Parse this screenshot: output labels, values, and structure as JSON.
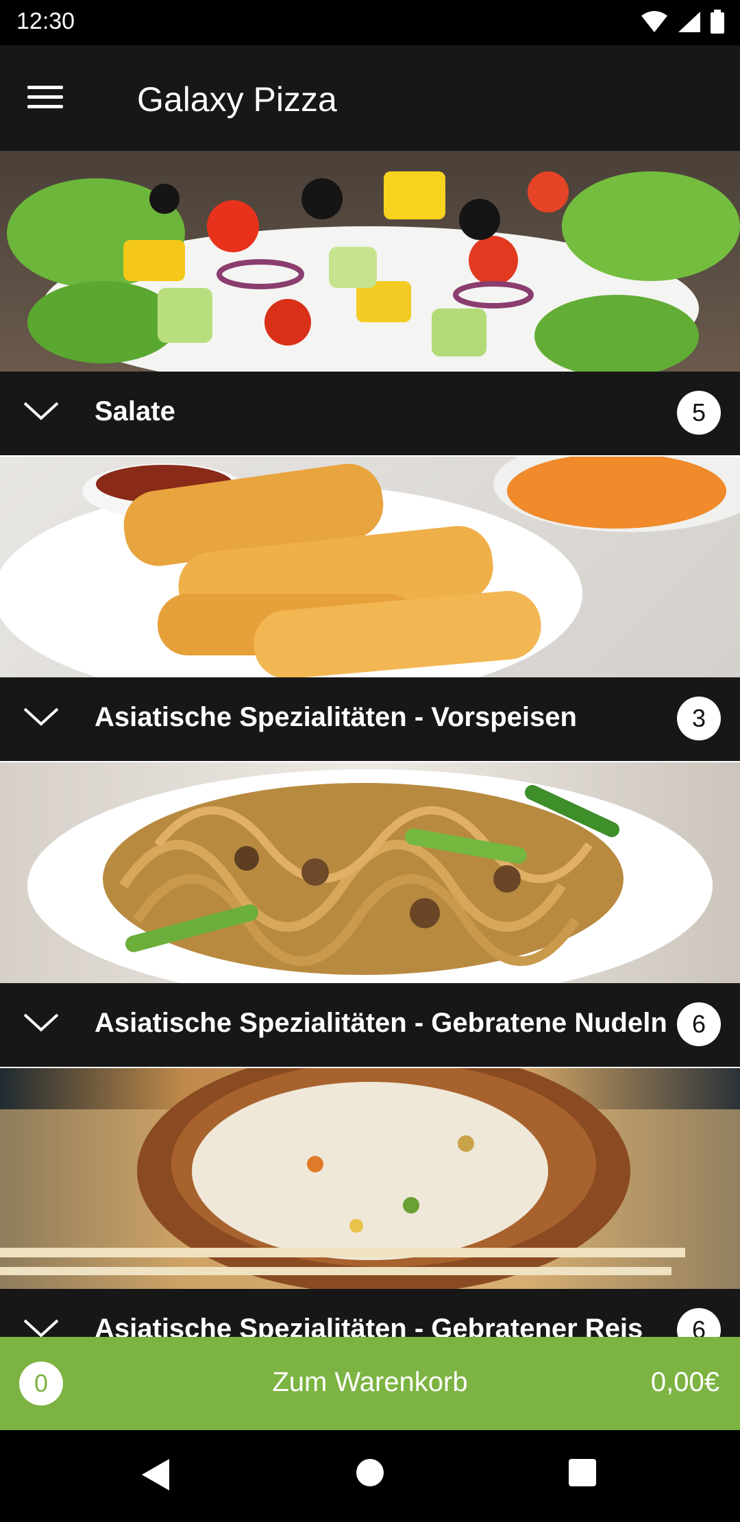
{
  "status_bar": {
    "time": "12:30"
  },
  "app_bar": {
    "title": "Galaxy Pizza"
  },
  "categories": [
    {
      "label": "Salate",
      "count": "5"
    },
    {
      "label": "Asiatische Spezialitäten - Vorspeisen",
      "count": "3"
    },
    {
      "label": "Asiatische Spezialitäten - Gebratene Nudeln",
      "count": "6"
    },
    {
      "label": "Asiatische Spezialitäten - Gebratener Reis",
      "count": "6"
    }
  ],
  "cart": {
    "count": "0",
    "label": "Zum Warenkorb",
    "total": "0,00€"
  },
  "colors": {
    "accent": "#7cb342",
    "appbar": "#171717"
  }
}
